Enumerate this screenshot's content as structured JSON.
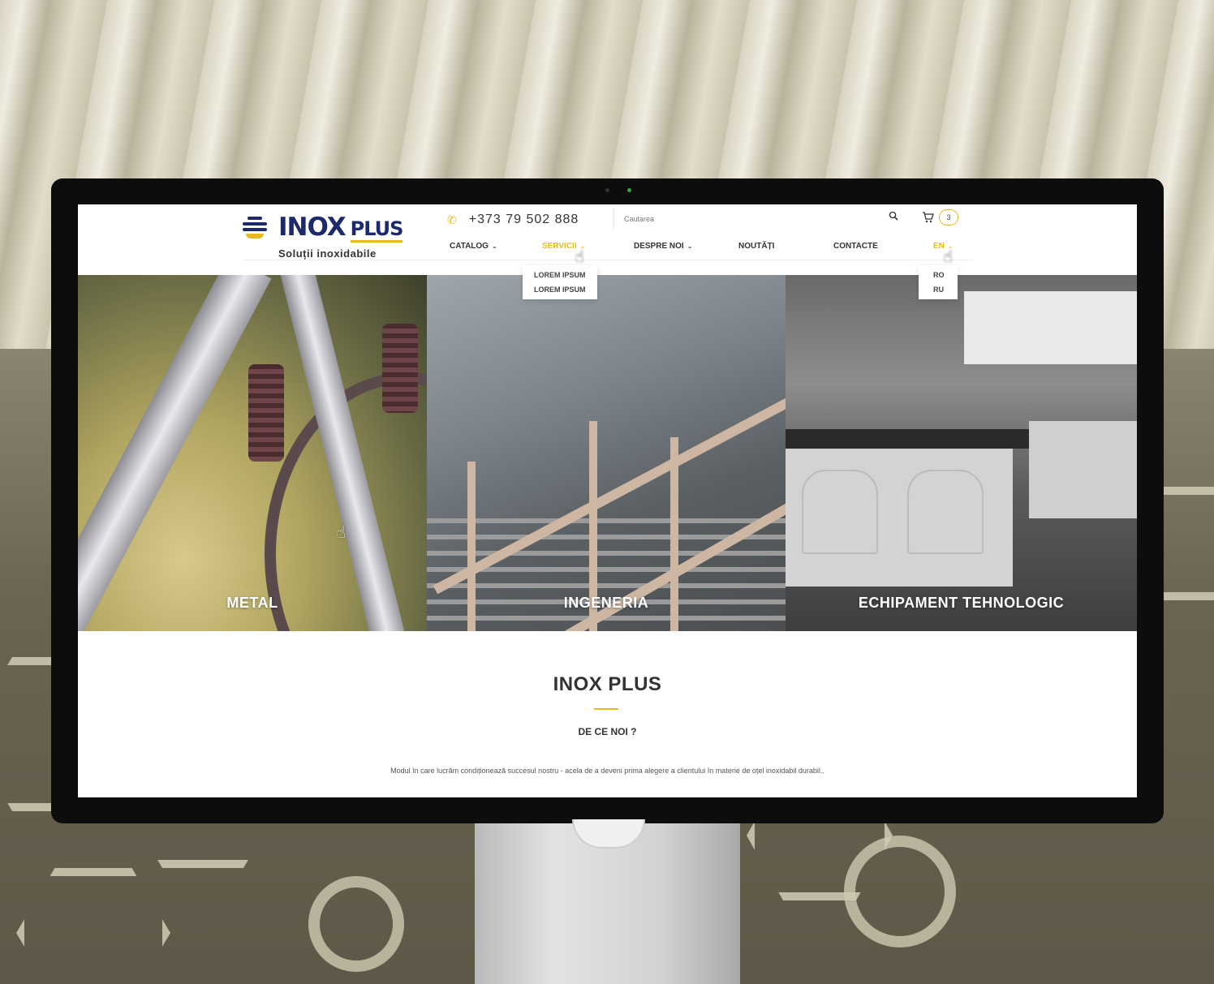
{
  "brand": {
    "name": "INOX",
    "name_suffix": "PLUS",
    "tagline": "Soluții inoxidabile"
  },
  "contact": {
    "phone": "+373 79 502 888"
  },
  "search": {
    "placeholder": "Cautarea"
  },
  "cart": {
    "count": "3"
  },
  "nav": {
    "items": [
      {
        "label": "CATALOG"
      },
      {
        "label": "SERVICII"
      },
      {
        "label": "DESPRE NOI"
      },
      {
        "label": "NOUTĂȚI"
      },
      {
        "label": "CONTACTE"
      },
      {
        "label": "EN"
      }
    ],
    "services_dropdown": [
      "LOREM IPSUM",
      "LOREM IPSUM"
    ],
    "language_dropdown": [
      "RO",
      "RU"
    ]
  },
  "hero": {
    "panels": [
      {
        "label": "METAL"
      },
      {
        "label": "INGENERIA"
      },
      {
        "label": "ECHIPAMENT TEHNOLOGIC"
      }
    ]
  },
  "about": {
    "title": "INOX PLUS",
    "subtitle": "DE CE NOI ?",
    "text": "Modul în care lucrăm condiționează succesul nostru - acela de a deveni  prima alegere a clientului în materie de oțel inoxidabil durabil.."
  },
  "colors": {
    "accent": "#e8b923",
    "brand": "#1c2a6b"
  }
}
